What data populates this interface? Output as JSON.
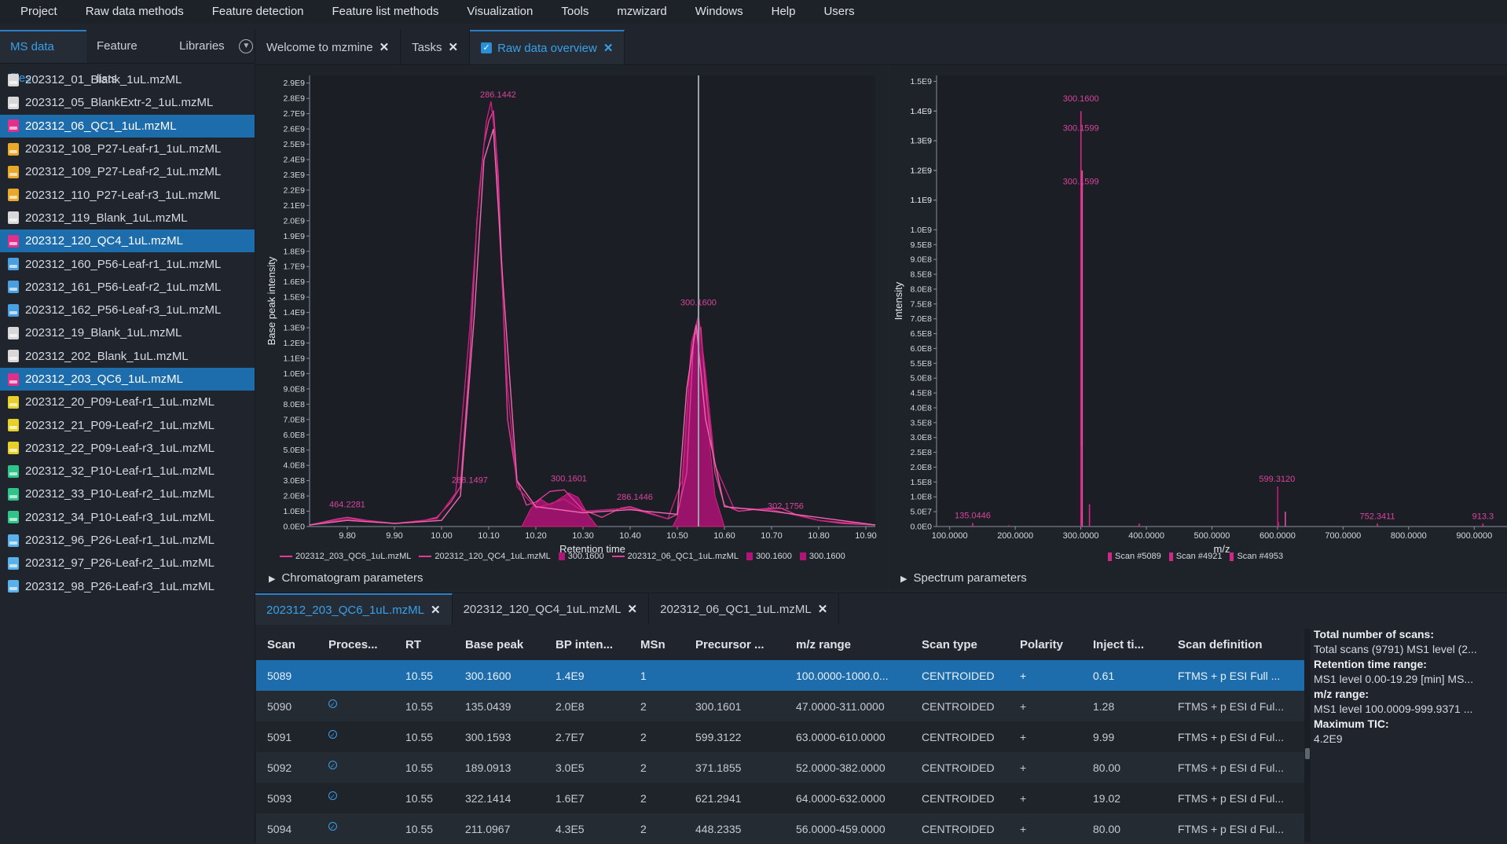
{
  "menu": [
    "Project",
    "Raw data methods",
    "Feature detection",
    "Feature list methods",
    "Visualization",
    "Tools",
    "mzwizard",
    "Windows",
    "Help",
    "Users"
  ],
  "sidebar": {
    "tabs": [
      "MS data files",
      "Feature lists",
      "Libraries"
    ],
    "files": [
      {
        "name": "202312_01_Blank_1uL.mzML",
        "color": "#d8d8d8",
        "selected": false
      },
      {
        "name": "202312_05_BlankExtr-2_1uL.mzML",
        "color": "#d8d8d8",
        "selected": false
      },
      {
        "name": "202312_06_QC1_1uL.mzML",
        "color": "#e0308c",
        "selected": true
      },
      {
        "name": "202312_108_P27-Leaf-r1_1uL.mzML",
        "color": "#e8a82a",
        "selected": false
      },
      {
        "name": "202312_109_P27-Leaf-r2_1uL.mzML",
        "color": "#e8a82a",
        "selected": false
      },
      {
        "name": "202312_110_P27-Leaf-r3_1uL.mzML",
        "color": "#e8a82a",
        "selected": false
      },
      {
        "name": "202312_119_Blank_1uL.mzML",
        "color": "#d8d8d8",
        "selected": false
      },
      {
        "name": "202312_120_QC4_1uL.mzML",
        "color": "#e0308c",
        "selected": true
      },
      {
        "name": "202312_160_P56-Leaf-r1_1uL.mzML",
        "color": "#4a9fe0",
        "selected": false
      },
      {
        "name": "202312_161_P56-Leaf-r2_1uL.mzML",
        "color": "#4a9fe0",
        "selected": false
      },
      {
        "name": "202312_162_P56-Leaf-r3_1uL.mzML",
        "color": "#4a9fe0",
        "selected": false
      },
      {
        "name": "202312_19_Blank_1uL.mzML",
        "color": "#d8d8d8",
        "selected": false
      },
      {
        "name": "202312_202_Blank_1uL.mzML",
        "color": "#d8d8d8",
        "selected": false
      },
      {
        "name": "202312_203_QC6_1uL.mzML",
        "color": "#e0308c",
        "selected": true
      },
      {
        "name": "202312_20_P09-Leaf-r1_1uL.mzML",
        "color": "#e8d02a",
        "selected": false
      },
      {
        "name": "202312_21_P09-Leaf-r2_1uL.mzML",
        "color": "#e8d02a",
        "selected": false
      },
      {
        "name": "202312_22_P09-Leaf-r3_1uL.mzML",
        "color": "#e8d02a",
        "selected": false
      },
      {
        "name": "202312_32_P10-Leaf-r1_1uL.mzML",
        "color": "#2ec48a",
        "selected": false
      },
      {
        "name": "202312_33_P10-Leaf-r2_1uL.mzML",
        "color": "#2ec48a",
        "selected": false
      },
      {
        "name": "202312_34_P10-Leaf-r3_1uL.mzML",
        "color": "#2ec48a",
        "selected": false
      },
      {
        "name": "202312_96_P26-Leaf-r1_1uL.mzML",
        "color": "#5ab0e8",
        "selected": false
      },
      {
        "name": "202312_97_P26-Leaf-r2_1uL.mzML",
        "color": "#5ab0e8",
        "selected": false
      },
      {
        "name": "202312_98_P26-Leaf-r3_1uL.mzML",
        "color": "#5ab0e8",
        "selected": false
      }
    ]
  },
  "doc_tabs": {
    "welcome": "Welcome to mzmine",
    "tasks": "Tasks",
    "raw": "Raw data overview"
  },
  "chromatogram": {
    "param_label": "Chromatogram parameters",
    "legend": [
      {
        "label": "202312_203_QC6_1uL.mzML",
        "kind": "line"
      },
      {
        "label": "202312_120_QC4_1uL.mzML",
        "kind": "line"
      },
      {
        "label": "300.1600",
        "kind": "box"
      },
      {
        "label": "202312_06_QC1_1uL.mzML",
        "kind": "line"
      },
      {
        "label": "300.1600",
        "kind": "box"
      },
      {
        "label": "300.1600",
        "kind": "box"
      }
    ]
  },
  "spectrum": {
    "param_label": "Spectrum parameters",
    "legend": [
      "Scan #5089",
      "Scan #4921",
      "Scan #4953"
    ]
  },
  "chart_data": [
    {
      "type": "line",
      "title": "",
      "xlabel": "Retention time",
      "ylabel": "Base peak intensity",
      "xlim": [
        9.72,
        10.92
      ],
      "ylim": [
        0,
        2950000000.0
      ],
      "x_ticks": [
        "9.80",
        "9.90",
        "10.00",
        "10.10",
        "10.20",
        "10.30",
        "10.40",
        "10.50",
        "10.60",
        "10.70",
        "10.80",
        "10.90"
      ],
      "y_ticks": [
        "0.0E0",
        "1.0E8",
        "2.0E8",
        "3.0E8",
        "4.0E8",
        "5.0E8",
        "6.0E8",
        "7.0E8",
        "8.0E8",
        "9.0E8",
        "1.0E9",
        "1.1E9",
        "1.2E9",
        "1.3E9",
        "1.4E9",
        "1.5E9",
        "1.6E9",
        "1.7E9",
        "1.8E9",
        "1.9E9",
        "2.0E9",
        "2.1E9",
        "2.2E9",
        "2.3E9",
        "2.4E9",
        "2.5E9",
        "2.6E9",
        "2.7E9",
        "2.8E9",
        "2.9E9"
      ],
      "cursor_rt": 10.545,
      "series": [
        {
          "name": "202312_203_QC6_1uL.mzML",
          "x": [
            9.72,
            9.78,
            9.8,
            9.84,
            9.9,
            9.95,
            9.99,
            10.02,
            10.04,
            10.06,
            10.075,
            10.09,
            10.1,
            10.11,
            10.12,
            10.13,
            10.14,
            10.16,
            10.18,
            10.2,
            10.23,
            10.26,
            10.3,
            10.34,
            10.38,
            10.4,
            10.44,
            10.48,
            10.5,
            10.52,
            10.535,
            10.55,
            10.56,
            10.58,
            10.6,
            10.63,
            10.66,
            10.7,
            10.72,
            10.75,
            10.8,
            10.85,
            10.92
          ],
          "y": [
            10000000.0,
            50000000.0,
            60000000.0,
            40000000.0,
            20000000.0,
            30000000.0,
            60000000.0,
            160000000.0,
            260000000.0,
            1100000000.0,
            2000000000.0,
            2500000000.0,
            2650000000.0,
            2720000000.0,
            2300000000.0,
            1500000000.0,
            700000000.0,
            300000000.0,
            140000000.0,
            160000000.0,
            230000000.0,
            240000000.0,
            110000000.0,
            60000000.0,
            120000000.0,
            130000000.0,
            90000000.0,
            50000000.0,
            80000000.0,
            350000000.0,
            1250000000.0,
            1300000000.0,
            900000000.0,
            350000000.0,
            140000000.0,
            100000000.0,
            110000000.0,
            120000000.0,
            120000000.0,
            80000000.0,
            40000000.0,
            20000000.0,
            10000000.0
          ]
        },
        {
          "name": "202312_120_QC4_1uL.mzML",
          "x": [
            9.72,
            9.8,
            9.9,
            9.99,
            10.03,
            10.06,
            10.08,
            10.095,
            10.105,
            10.115,
            10.125,
            10.14,
            10.16,
            10.2,
            10.26,
            10.3,
            10.4,
            10.48,
            10.51,
            10.53,
            10.545,
            10.56,
            10.58,
            10.62,
            10.7,
            10.8,
            10.92
          ],
          "y": [
            10000000.0,
            50000000.0,
            20000000.0,
            50000000.0,
            220000000.0,
            1300000000.0,
            2200000000.0,
            2650000000.0,
            2780000000.0,
            2500000000.0,
            1800000000.0,
            900000000.0,
            260000000.0,
            120000000.0,
            180000000.0,
            100000000.0,
            120000000.0,
            50000000.0,
            300000000.0,
            1200000000.0,
            1380000000.0,
            1000000000.0,
            400000000.0,
            120000000.0,
            110000000.0,
            40000000.0,
            10000000.0
          ]
        },
        {
          "name": "202312_06_QC1_1uL.mzML",
          "x": [
            9.72,
            9.8,
            9.9,
            10.0,
            10.04,
            10.07,
            10.09,
            10.11,
            10.13,
            10.16,
            10.2,
            10.3,
            10.4,
            10.5,
            10.52,
            10.54,
            10.56,
            10.6,
            10.7,
            10.92
          ],
          "y": [
            10000000.0,
            40000000.0,
            20000000.0,
            40000000.0,
            200000000.0,
            1400000000.0,
            2400000000.0,
            2600000000.0,
            1600000000.0,
            300000000.0,
            130000000.0,
            90000000.0,
            110000000.0,
            80000000.0,
            900000000.0,
            1320000000.0,
            700000000.0,
            130000000.0,
            100000000.0,
            10000000.0
          ]
        }
      ],
      "filled_peaks": [
        {
          "name": "300.1600",
          "x": [
            10.17,
            10.19,
            10.21,
            10.23,
            10.25,
            10.27,
            10.29,
            10.31,
            10.33
          ],
          "y": [
            0,
            120000000.0,
            180000000.0,
            140000000.0,
            180000000.0,
            220000000.0,
            190000000.0,
            80000000.0,
            0
          ]
        },
        {
          "name": "300.1600",
          "x": [
            10.49,
            10.5,
            10.51,
            10.52,
            10.53,
            10.545,
            10.56,
            10.57,
            10.58,
            10.6
          ],
          "y": [
            0,
            60000000.0,
            250000000.0,
            700000000.0,
            1200000000.0,
            1360000000.0,
            1000000000.0,
            500000000.0,
            200000000.0,
            0
          ]
        }
      ],
      "labels": [
        {
          "text": "464.2281",
          "x": 9.8,
          "y": 100000000.0
        },
        {
          "text": "286.1442",
          "x": 10.12,
          "y": 2780000000.0
        },
        {
          "text": "288.1497",
          "x": 10.06,
          "y": 260000000.0
        },
        {
          "text": "300.1601",
          "x": 10.27,
          "y": 270000000.0
        },
        {
          "text": "286.1446",
          "x": 10.41,
          "y": 150000000.0
        },
        {
          "text": "300.1600",
          "x": 10.545,
          "y": 1420000000.0
        },
        {
          "text": "302.1756",
          "x": 10.73,
          "y": 90000000.0
        }
      ]
    },
    {
      "type": "bar",
      "title": "",
      "xlabel": "m/z",
      "ylabel": "Intensity",
      "xlim": [
        80,
        950
      ],
      "ylim": [
        0,
        1520000000.0
      ],
      "x_ticks": [
        "100.0000",
        "200.0000",
        "300.0000",
        "400.0000",
        "500.0000",
        "600.0000",
        "700.0000",
        "800.0000",
        "900.0000"
      ],
      "y_ticks": [
        "0.0E0",
        "5.0E7",
        "1.0E8",
        "1.5E8",
        "2.0E8",
        "2.5E8",
        "3.0E8",
        "3.5E8",
        "4.0E8",
        "4.5E8",
        "5.0E8",
        "5.5E8",
        "6.0E8",
        "6.5E8",
        "7.0E8",
        "7.5E8",
        "8.0E8",
        "8.5E8",
        "9.0E8",
        "9.5E8",
        "1.0E9",
        "1.1E9",
        "1.1E9",
        "1.2E9",
        "1.2E9",
        "1.3E9",
        "1.3E9",
        "1.4E9",
        "1.4E9",
        "1.5E9"
      ],
      "series": [
        {
          "name": "Scan #5089",
          "x": [
            135.0446,
            300.16,
            313.2,
            389.0,
            601.3,
            752.3,
            913.3
          ],
          "y": [
            12000000.0,
            1400000000.0,
            75000000.0,
            10000000.0,
            15000000.0,
            10000000.0,
            10000000.0
          ]
        },
        {
          "name": "Scan #4921",
          "x": [
            300.1599,
            599.312,
            189.09
          ],
          "y": [
            270000000.0,
            135000000.0,
            5000000.0
          ]
        },
        {
          "name": "Scan #4953",
          "x": [
            300.1599,
            610.0
          ],
          "y": [
            1200000000.0,
            50000000.0
          ]
        }
      ],
      "labels": [
        {
          "text": "300.1600",
          "x": 300.16,
          "y": 1420000000.0
        },
        {
          "text": "300.1599",
          "x": 300.16,
          "y": 1320000000.0
        },
        {
          "text": "300.1599",
          "x": 300.16,
          "y": 1140000000.0
        },
        {
          "text": "135.0446",
          "x": 135.0446,
          "y": 15000000.0
        },
        {
          "text": "599.3120",
          "x": 599.312,
          "y": 138000000.0
        },
        {
          "text": "752.3411",
          "x": 752.3,
          "y": 12000000.0
        },
        {
          "text": "913.3",
          "x": 913.3,
          "y": 12000000.0
        }
      ]
    }
  ],
  "bottom_tabs": [
    "202312_203_QC6_1uL.mzML",
    "202312_120_QC4_1uL.mzML",
    "202312_06_QC1_1uL.mzML"
  ],
  "table": {
    "headers": [
      "Scan",
      "Proces...",
      "RT",
      "Base peak",
      "BP inten...",
      "MSn",
      "Precursor ...",
      "m/z range",
      "Scan type",
      "Polarity",
      "Inject ti...",
      "Scan definition"
    ],
    "rows": [
      {
        "scan": "5089",
        "processed": false,
        "rt": "10.55",
        "base_peak": "300.1600",
        "bp_int": "1.4E9",
        "msn": "1",
        "precursor": "",
        "mz_range": "100.0000-1000.0...",
        "scan_type": "CENTROIDED",
        "polarity": "+",
        "inject": "0.61",
        "scan_def": "FTMS + p ESI Full ..."
      },
      {
        "scan": "5090",
        "processed": true,
        "rt": "10.55",
        "base_peak": "135.0439",
        "bp_int": "2.0E8",
        "msn": "2",
        "precursor": "300.1601",
        "mz_range": "47.0000-311.0000",
        "scan_type": "CENTROIDED",
        "polarity": "+",
        "inject": "1.28",
        "scan_def": "FTMS + p ESI d Ful..."
      },
      {
        "scan": "5091",
        "processed": true,
        "rt": "10.55",
        "base_peak": "300.1593",
        "bp_int": "2.7E7",
        "msn": "2",
        "precursor": "599.3122",
        "mz_range": "63.0000-610.0000",
        "scan_type": "CENTROIDED",
        "polarity": "+",
        "inject": "9.99",
        "scan_def": "FTMS + p ESI d Ful..."
      },
      {
        "scan": "5092",
        "processed": true,
        "rt": "10.55",
        "base_peak": "189.0913",
        "bp_int": "3.0E5",
        "msn": "2",
        "precursor": "371.1855",
        "mz_range": "52.0000-382.0000",
        "scan_type": "CENTROIDED",
        "polarity": "+",
        "inject": "80.00",
        "scan_def": "FTMS + p ESI d Ful..."
      },
      {
        "scan": "5093",
        "processed": true,
        "rt": "10.55",
        "base_peak": "322.1414",
        "bp_int": "1.6E7",
        "msn": "2",
        "precursor": "621.2941",
        "mz_range": "64.0000-632.0000",
        "scan_type": "CENTROIDED",
        "polarity": "+",
        "inject": "19.02",
        "scan_def": "FTMS + p ESI d Ful..."
      },
      {
        "scan": "5094",
        "processed": true,
        "rt": "10.55",
        "base_peak": "211.0967",
        "bp_int": "4.3E5",
        "msn": "2",
        "precursor": "448.2335",
        "mz_range": "56.0000-459.0000",
        "scan_type": "CENTROIDED",
        "polarity": "+",
        "inject": "80.00",
        "scan_def": "FTMS + p ESI d Ful..."
      }
    ]
  },
  "info": {
    "total_label": "Total number of scans:",
    "total_value": "Total scans (9791) MS1 level (2...",
    "rt_label": "Retention time range:",
    "rt_value": "MS1 level 0.00-19.29 [min] MS...",
    "mz_label": "m/z range:",
    "mz_value": "MS1 level 100.0009-999.9371 ...",
    "tic_label": "Maximum TIC:",
    "tic_value": "4.2E9"
  },
  "colors": {
    "accent": "#39a0e8",
    "selection": "#1d6cab",
    "trace": "#e03b97",
    "fill": "#b0157a",
    "label": "#d8449b"
  }
}
